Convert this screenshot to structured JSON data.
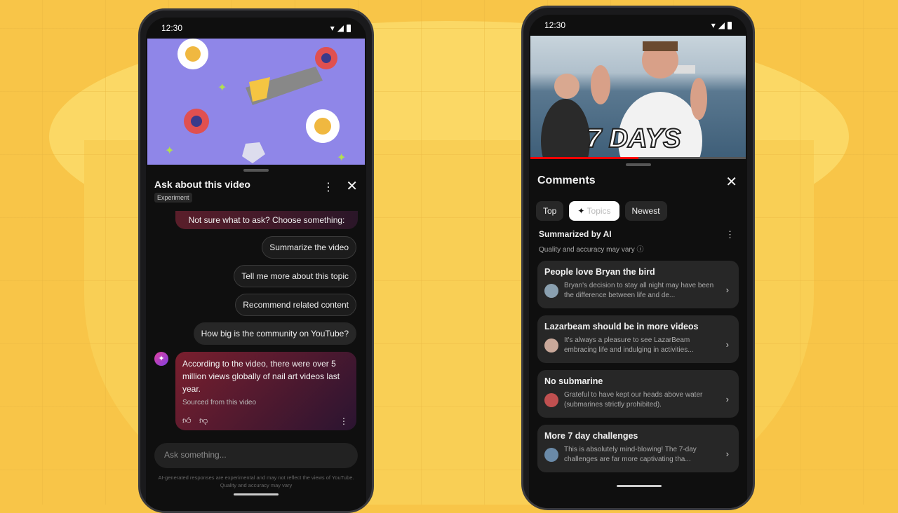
{
  "left_phone": {
    "status": {
      "time": "12:30"
    },
    "sheet": {
      "title": "Ask about this video",
      "badge": "Experiment"
    },
    "prompt": "Not sure what to ask? Choose something:",
    "suggestions": [
      "Summarize the video",
      "Tell me more about this topic",
      "Recommend related content"
    ],
    "user_question": "How big is the community on YouTube?",
    "answer": {
      "text": "According to the video, there were over 5 million views globally of nail art videos last year.",
      "source": "Sourced from this video"
    },
    "input": {
      "placeholder": "Ask something..."
    },
    "disclaimer": "AI-generated responses are experimental and may not reflect the views of YouTube. Quality and accuracy may vary"
  },
  "right_phone": {
    "status": {
      "time": "12:30"
    },
    "video": {
      "overlay_text": "7 DAYS"
    },
    "sheet": {
      "title": "Comments"
    },
    "tabs": [
      {
        "label": "Top"
      },
      {
        "label": "Topics",
        "active": true
      },
      {
        "label": "Newest"
      }
    ],
    "summary": {
      "title": "Summarized by AI",
      "subtitle": "Quality and accuracy may vary"
    },
    "topics": [
      {
        "title": "People love Bryan the bird",
        "text": "Bryan's decision to stay all night may have been the difference between life and de..."
      },
      {
        "title": "Lazarbeam should be in more videos",
        "text": "It's always a pleasure to see LazarBeam embracing life and indulging in activities..."
      },
      {
        "title": "No submarine",
        "text": "Grateful to have kept our heads above water (submarines strictly prohibited)."
      },
      {
        "title": "More 7 day challenges",
        "text": "This is absolutely mind-blowing! The 7-day challenges are far more captivating tha..."
      }
    ]
  },
  "colors": {
    "background": "#f8c548",
    "progress": "#ff0000",
    "ai_gradient": "#7a1f2e"
  }
}
